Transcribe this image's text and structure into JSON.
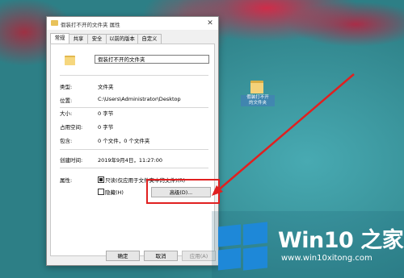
{
  "dialog": {
    "title": "假装打不开的文件夹 属性",
    "close_glyph": "✕",
    "tabs": [
      {
        "label": "常规",
        "active": true
      },
      {
        "label": "共享",
        "active": false
      },
      {
        "label": "安全",
        "active": false
      },
      {
        "label": "以前的版本",
        "active": false
      },
      {
        "label": "自定义",
        "active": false
      }
    ],
    "folder_name": "假装打不开的文件夹",
    "rows": {
      "type": {
        "label": "类型:",
        "value": "文件夹"
      },
      "location": {
        "label": "位置:",
        "value": "C:\\Users\\Administrator\\Desktop"
      },
      "size": {
        "label": "大小:",
        "value": "0 字节"
      },
      "size_on_disk": {
        "label": "占用空间:",
        "value": "0 字节"
      },
      "contains": {
        "label": "包含:",
        "value": "0 个文件，0 个文件夹"
      },
      "created": {
        "label": "创建时间:",
        "value": "2019年9月4日，11:27:00"
      }
    },
    "attributes": {
      "label": "属性:",
      "readonly": {
        "label": "只读(仅应用于文件夹中的文件)(R)",
        "checked": true
      },
      "hidden": {
        "label": "隐藏(H)",
        "checked": false
      },
      "advanced_button": "高级(D)..."
    },
    "buttons": {
      "ok": "确定",
      "cancel": "取消",
      "apply": "应用(A)"
    }
  },
  "desktop_icon": {
    "label_line1": "假装打不开",
    "label_line2": "的文件夹"
  },
  "watermark": {
    "title": "Win10 之家",
    "url": "www.win10xitong.com"
  },
  "accent_colors": {
    "highlight": "#e02020",
    "windows_blue": "#1e88d8"
  }
}
